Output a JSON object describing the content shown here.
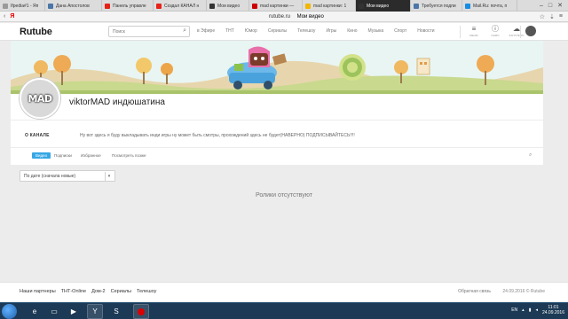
{
  "browser": {
    "tabs": [
      {
        "label": "Ifpedia#1 - Яп",
        "color": "#9a9a9a"
      },
      {
        "label": "Дана Апостолов",
        "color": "#4a76a8"
      },
      {
        "label": "Панель управле",
        "color": "#e62117"
      },
      {
        "label": "Создал КАНАЛ н",
        "color": "#e62117"
      },
      {
        "label": "Мои видео",
        "color": "#333333"
      },
      {
        "label": "mad картинки —",
        "color": "#cc0000"
      },
      {
        "label": "mad картинки: 1",
        "color": "#f2b600"
      },
      {
        "label": "Мои видео",
        "color": "#333333",
        "active": true
      },
      {
        "label": "Требуется подпи",
        "color": "#4a76a8"
      },
      {
        "label": "Mail.Ru: почта, п",
        "color": "#168de2"
      }
    ],
    "url_domain": "rutube.ru",
    "url_title": "Мои видео"
  },
  "site": {
    "logo": "Rutube",
    "search_placeholder": "Поиск",
    "nav": [
      "в Эфире",
      "ТНТ",
      "Юмор",
      "Сериалы",
      "Телешоу",
      "Игры",
      "Кино",
      "Музыка",
      "Спорт",
      "Новости"
    ],
    "header_icons": [
      {
        "icon": "menu-icon",
        "label": "МЕНЮ"
      },
      {
        "icon": "info-icon",
        "label": "ИНФО"
      },
      {
        "icon": "upload-icon",
        "label": "ЗАГРУЗИТЬ"
      }
    ]
  },
  "channel": {
    "avatar_text": "MAD",
    "name": "viktorMAD индюшатина",
    "about_label": "О КАНАЛЕ",
    "about_text": "Ну вот здесь я буду выкладывать инди игры ну может быть смотры, прохождений здесь не будет(НАВЕРНО) ПОДПИСЫВАЙТЕСЬ!!!!",
    "tabs": [
      {
        "label": "Видео",
        "active": true
      },
      {
        "label": "Подписки"
      },
      {
        "label": "Избранное"
      },
      {
        "label": "Посмотреть позже"
      }
    ]
  },
  "sort": {
    "selected": "По дате (сначала новые)"
  },
  "empty_message": "Ролики отсутствуют",
  "footer": {
    "links": [
      "Наши партнеры",
      "ТНТ-Online",
      "Дом-2",
      "Сериалы",
      "Телешоу"
    ],
    "feedback": "Обратная связь",
    "copyright": "24.09.2016 © Rutube"
  },
  "taskbar": {
    "lang": "EN",
    "time": "11:01",
    "date": "24.09.2016"
  },
  "colors": {
    "accent": "#36a7e6",
    "taskbar": "#1c3a55"
  }
}
